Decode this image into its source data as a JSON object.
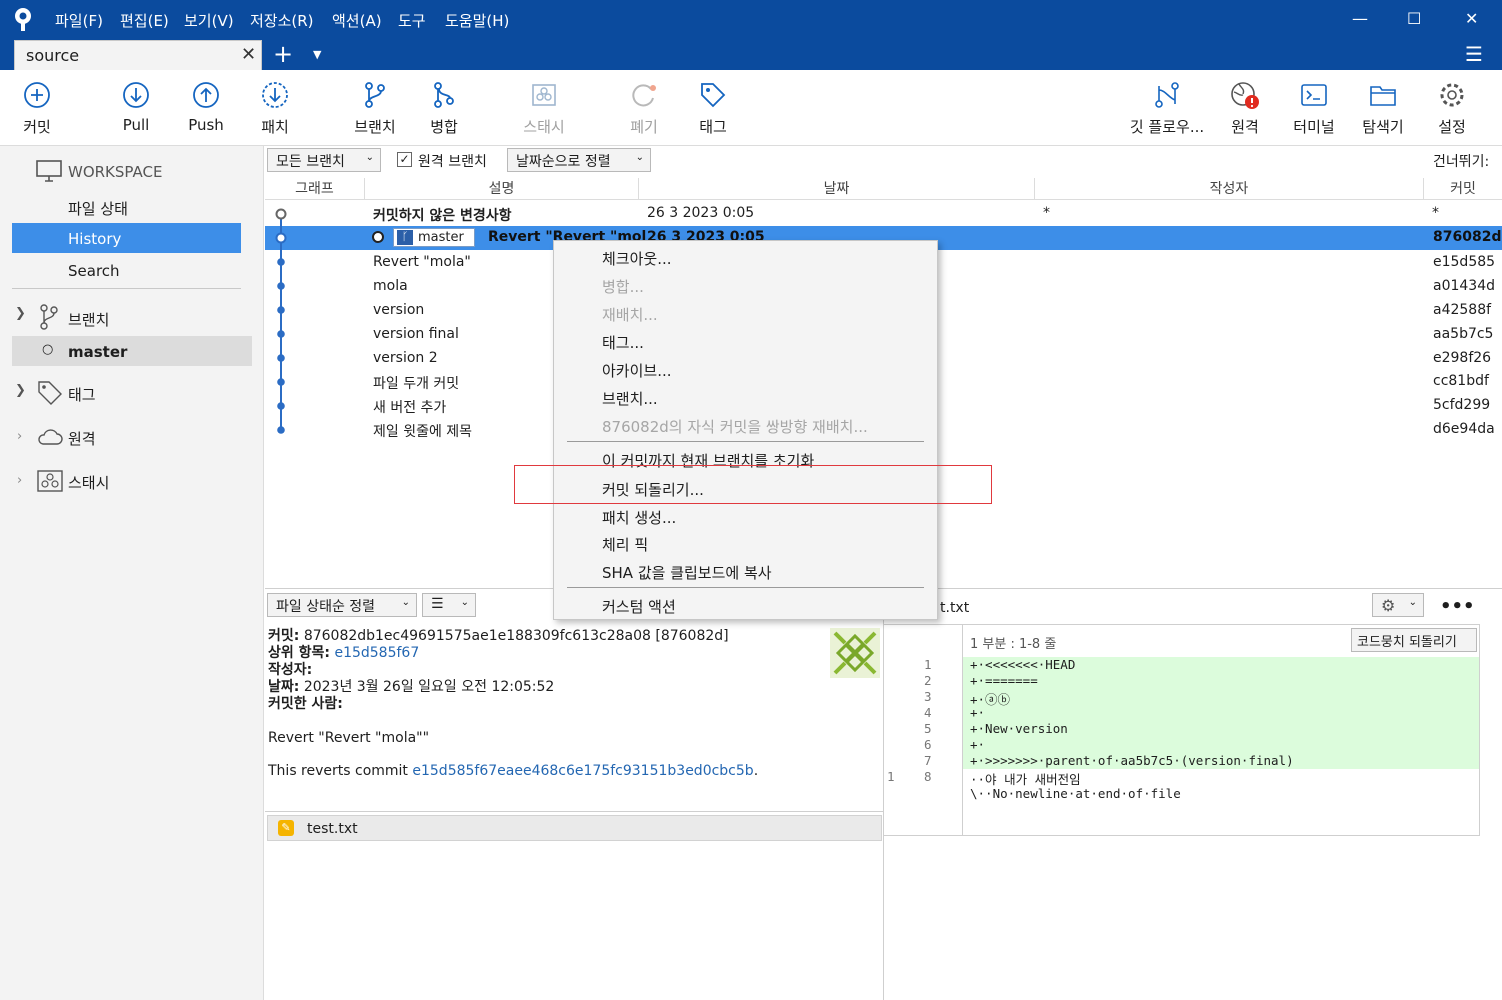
{
  "menu": [
    "파일(F)",
    "편집(E)",
    "보기(V)",
    "저장소(R)",
    "액션(A)",
    "도구",
    "도움말(H)"
  ],
  "tab": {
    "title": "source"
  },
  "toolbar": {
    "commit": "커밋",
    "pull": "Pull",
    "push": "Push",
    "fetch": "패치",
    "branch": "브랜치",
    "merge": "병합",
    "stash": "스태시",
    "discard": "폐기",
    "tag": "태그",
    "gitflow": "깃 플로우...",
    "remote": "원격",
    "terminal": "터미널",
    "explorer": "탐색기",
    "settings": "설정"
  },
  "sidebar": {
    "workspace": "WORKSPACE",
    "file_status": "파일 상태",
    "history": "History",
    "search": "Search",
    "branches": "브랜치",
    "master": "master",
    "tags": "태그",
    "remotes": "원격",
    "stashes": "스태시"
  },
  "filter": {
    "all_branches": "모든 브랜치",
    "show_remote": "원격 브랜치",
    "sort": "날짜순으로 정렬",
    "jump": "건너뛰기:"
  },
  "columns": {
    "graph": "그래프",
    "description": "설명",
    "date": "날짜",
    "author": "작성자",
    "commit": "커밋"
  },
  "commits": [
    {
      "desc": "커밋하지 않은 변경사항",
      "date": "26 3 2023 0:05",
      "author": "*",
      "hash": "*"
    },
    {
      "desc": "Revert \"Revert \"mol",
      "date": "26 3 2023 0:05",
      "author": "",
      "hash": "876082d",
      "branch": "master"
    },
    {
      "desc": "Revert \"mola\"",
      "date": "",
      "author": "",
      "hash": "e15d585"
    },
    {
      "desc": "mola",
      "date": "",
      "author": "",
      "hash": "a01434d"
    },
    {
      "desc": "version",
      "date": "",
      "author": "",
      "hash": "a42588f"
    },
    {
      "desc": "version final",
      "date": "",
      "author": "",
      "hash": "aa5b7c5"
    },
    {
      "desc": "version 2",
      "date": "",
      "author": "",
      "hash": "e298f26"
    },
    {
      "desc": "파일 두개 커밋",
      "date": "",
      "author": "",
      "hash": "cc81bdf"
    },
    {
      "desc": "새 버전 추가",
      "date": "",
      "author": "",
      "hash": "5cfd299"
    },
    {
      "desc": "제일 윗줄에 제목",
      "date": "",
      "author": "",
      "hash": "d6e94da"
    }
  ],
  "context_menu": {
    "checkout": "체크아웃...",
    "merge": "병합...",
    "rebase": "재배치...",
    "tag": "태그...",
    "archive": "아카이브...",
    "branch": "브랜치...",
    "interactive_rebase": "876082d의 자식 커밋을 쌍방향 재배치...",
    "reset": "이 커밋까지 현재 브랜치를 초기화",
    "revert": "커밋 되돌리기...",
    "patch": "패치 생성...",
    "cherry_pick": "체리 픽",
    "copy_sha": "SHA 값을 클립보드에 복사",
    "custom_actions": "커스텀 액션"
  },
  "bottom": {
    "sort": "파일 상태순 정렬",
    "list_icon": "☰",
    "commit_label": "커밋:",
    "commit_value": "876082db1ec49691575ae1e188309fc613c28a08 [876082d]",
    "parent_label": "상위 항목:",
    "parent_value": "e15d585f67",
    "author_label": "작성자:",
    "date_label": "날짜:",
    "date_value": "2023년 3월 26일 일요일 오전 12:05:52",
    "committer_label": "커밋한 사람:",
    "message": "Revert \"Revert \"mola\"\"",
    "reverts_prefix": "This reverts commit ",
    "reverts_hash": "e15d585f67eaee468c6e175fc93151b3ed0cbc5b",
    "reverts_suffix": ".",
    "file": "test.txt",
    "diff_file": "t.txt",
    "hunk": "1 부분 : 1-8 줄",
    "revert_hunk": "코드뭉치 되돌리기"
  },
  "diff": [
    {
      "old": "",
      "new": "1",
      "text": "+·<<<<<<<·HEAD",
      "added": true
    },
    {
      "old": "",
      "new": "2",
      "text": "+·=======",
      "added": true
    },
    {
      "old": "",
      "new": "3",
      "text": "+·ⓐⓑ",
      "added": true
    },
    {
      "old": "",
      "new": "4",
      "text": "+·",
      "added": true
    },
    {
      "old": "",
      "new": "5",
      "text": "+·New·version",
      "added": true
    },
    {
      "old": "",
      "new": "6",
      "text": "+·",
      "added": true
    },
    {
      "old": "",
      "new": "7",
      "text": "+·>>>>>>>·parent·of·aa5b7c5·(version·final)",
      "added": true
    },
    {
      "old": "1",
      "new": "8",
      "text": "··야 내가 새버전임",
      "added": false
    },
    {
      "old": "",
      "new": "",
      "text": "\\··No·newline·at·end·of·file",
      "added": false
    }
  ]
}
